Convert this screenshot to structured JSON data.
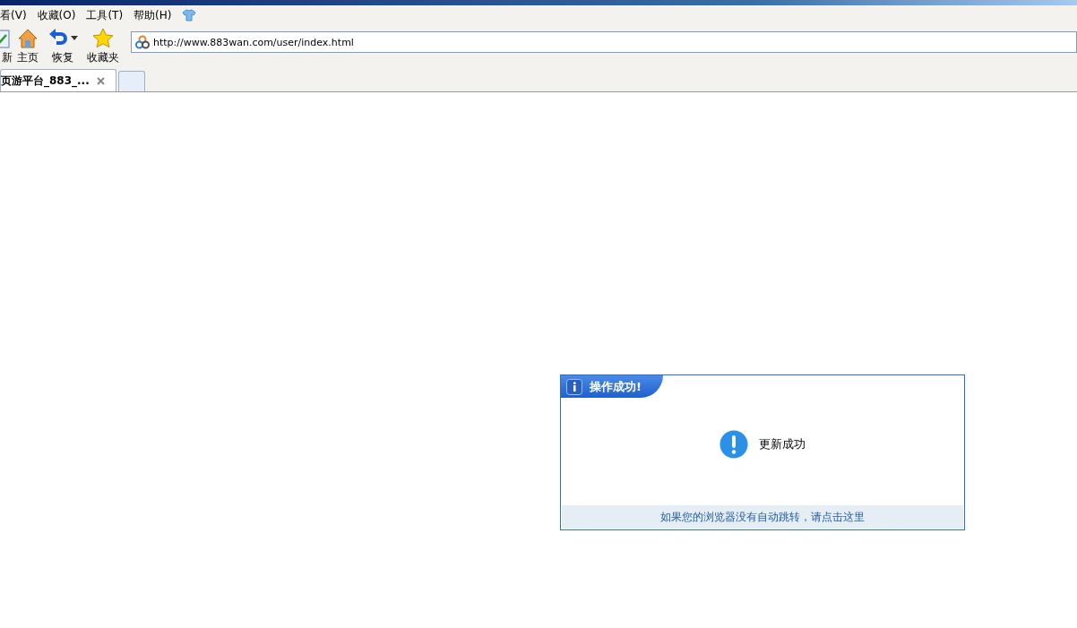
{
  "menu": [
    "看(V)",
    "收藏(O)",
    "工具(T)",
    "帮助(H)"
  ],
  "toolbar": [
    {
      "kind": "refresh",
      "label": "新"
    },
    {
      "kind": "home",
      "label": "主页"
    },
    {
      "kind": "restore",
      "label": "恢复"
    },
    {
      "kind": "favorites",
      "label": "收藏夹"
    }
  ],
  "address": {
    "value": "http://www.883wan.com/user/index.html"
  },
  "tabs": [
    {
      "label": "页游平台_883_...",
      "selected": true
    }
  ],
  "dialog": {
    "title": "操作成功!",
    "message": "更新成功",
    "link": "如果您的浏览器没有自动跳转，请点击这里"
  }
}
